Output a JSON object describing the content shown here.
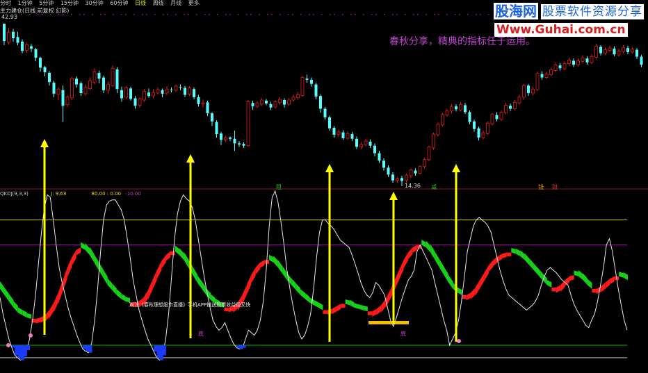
{
  "toolbar": {
    "items": [
      "分时",
      "1分钟",
      "5分钟",
      "15分钟",
      "30分钟",
      "60分钟",
      "日线",
      "周线",
      "月线",
      "更多"
    ],
    "active": "日线"
  },
  "chart_title": "主力建仓(日线 前复权 幻影)",
  "watermark": {
    "logo": "股海网",
    "tagline": "股票软件资源分享",
    "site": "Www.Guhai.com.cn"
  },
  "promo_text": "春秋分享，精典的指标任于运用。",
  "annotation": "观注《春秋理想股市直播》手机APP推送股票收益稳又快",
  "colors": {
    "up_candle": "#e81a1a",
    "down_candle": "#54ffff",
    "arrow": "#ffff00",
    "band_up": "#ff1a1a",
    "band_down": "#16d01a",
    "bottom_block": "#1a3aff",
    "line_upper": "#d2c000",
    "line_mid": "#b400b4",
    "line_lower": "#10b010"
  },
  "chart_data": [
    {
      "type": "candlestick",
      "high_label": "42.93",
      "low_label": "14.36",
      "markers": [
        "阻",
        "减",
        "钱",
        "财"
      ],
      "candles": [
        [
          42.5,
          39.5,
          40.2,
          38.8
        ],
        [
          39.3,
          41.0,
          41.8,
          38.9
        ],
        [
          41.1,
          40.0,
          41.6,
          39.4
        ],
        [
          40.2,
          39.2,
          41.1,
          38.8
        ],
        [
          39.4,
          37.8,
          39.8,
          37.4
        ],
        [
          37.9,
          38.9,
          39.2,
          37.5
        ],
        [
          38.6,
          38.2,
          39.0,
          37.6
        ],
        [
          38.1,
          36.6,
          38.3,
          36.0
        ],
        [
          36.6,
          34.9,
          36.8,
          34.2
        ],
        [
          35.0,
          34.1,
          35.2,
          33.4
        ],
        [
          34.0,
          32.4,
          34.3,
          31.8
        ],
        [
          32.3,
          30.4,
          32.6,
          29.8
        ],
        [
          30.3,
          31.2,
          31.5,
          29.3
        ],
        [
          31.0,
          28.3,
          31.8,
          25.5
        ],
        [
          28.5,
          29.8,
          30.2,
          28.1
        ],
        [
          29.7,
          33.0,
          33.3,
          29.3
        ],
        [
          33.0,
          32.0,
          33.4,
          31.4
        ],
        [
          32.2,
          30.5,
          32.5,
          30.0
        ],
        [
          30.4,
          31.5,
          32.0,
          30.0
        ],
        [
          31.3,
          32.6,
          33.2,
          31.0
        ],
        [
          32.4,
          34.2,
          34.8,
          32.0
        ],
        [
          34.0,
          33.0,
          34.4,
          32.2
        ],
        [
          33.2,
          31.0,
          33.5,
          30.5
        ],
        [
          31.0,
          32.0,
          32.5,
          30.4
        ],
        [
          31.8,
          34.8,
          35.3,
          31.6
        ],
        [
          34.6,
          31.2,
          35.0,
          30.5
        ],
        [
          31.0,
          29.6,
          31.6,
          29.0
        ],
        [
          29.8,
          31.4,
          31.7,
          29.5
        ],
        [
          31.3,
          29.5,
          31.6,
          29.2
        ],
        [
          29.6,
          28.3,
          30.0,
          27.8
        ],
        [
          28.4,
          29.5,
          29.8,
          28.0
        ],
        [
          29.3,
          30.8,
          31.2,
          29.0
        ],
        [
          30.6,
          30.0,
          31.3,
          29.7
        ],
        [
          30.0,
          30.6,
          31.2,
          29.6
        ],
        [
          30.5,
          31.1,
          31.5,
          30.2
        ],
        [
          31.0,
          30.4,
          31.3,
          29.8
        ],
        [
          30.5,
          31.2,
          31.7,
          30.2
        ],
        [
          31.1,
          31.0,
          31.5,
          30.6
        ],
        [
          31.0,
          31.7,
          32.0,
          30.7
        ],
        [
          31.6,
          31.5,
          32.0,
          31.0
        ],
        [
          31.4,
          30.2,
          31.7,
          29.8
        ],
        [
          30.3,
          31.4,
          31.7,
          30.0
        ],
        [
          31.2,
          29.8,
          31.5,
          29.4
        ],
        [
          29.8,
          28.6,
          30.2,
          28.2
        ],
        [
          28.6,
          28.8,
          29.4,
          28.0
        ],
        [
          28.9,
          27.0,
          29.2,
          26.5
        ],
        [
          27.0,
          25.6,
          27.2,
          24.8
        ],
        [
          25.5,
          23.4,
          25.8,
          22.8
        ],
        [
          23.5,
          22.4,
          23.8,
          21.5
        ],
        [
          22.4,
          22.8,
          23.1,
          22.0
        ],
        [
          22.8,
          22.6,
          23.0,
          22.2
        ],
        [
          22.6,
          21.8,
          24.0,
          20.5
        ],
        [
          21.8,
          21.6,
          22.2,
          21.2
        ],
        [
          21.7,
          21.4,
          22.0,
          21.0
        ],
        [
          21.4,
          29.0,
          29.3,
          21.2
        ],
        [
          28.8,
          28.2,
          29.2,
          27.6
        ],
        [
          28.2,
          28.8,
          29.1,
          27.9
        ],
        [
          28.6,
          29.3,
          29.6,
          28.3
        ],
        [
          29.2,
          28.7,
          29.5,
          28.4
        ],
        [
          28.6,
          28.0,
          29.0,
          27.6
        ],
        [
          28.1,
          29.0,
          29.3,
          27.8
        ],
        [
          28.9,
          29.4,
          29.8,
          28.5
        ],
        [
          29.3,
          28.5,
          29.6,
          28.0
        ],
        [
          28.6,
          29.3,
          29.6,
          28.3
        ],
        [
          29.3,
          29.8,
          30.3,
          29.0
        ],
        [
          29.7,
          30.2,
          30.7,
          29.4
        ],
        [
          30.1,
          33.2,
          33.5,
          29.9
        ],
        [
          33.0,
          32.8,
          33.7,
          32.3
        ],
        [
          32.8,
          32.1,
          33.2,
          31.6
        ],
        [
          32.0,
          29.9,
          32.3,
          29.4
        ],
        [
          30.0,
          27.8,
          30.3,
          27.1
        ],
        [
          27.8,
          26.3,
          28.1,
          25.9
        ],
        [
          26.3,
          24.4,
          26.6,
          24.0
        ],
        [
          24.5,
          23.3,
          24.8,
          22.8
        ],
        [
          23.4,
          23.8,
          24.2,
          22.9
        ],
        [
          23.7,
          22.7,
          24.1,
          22.4
        ],
        [
          22.7,
          23.5,
          23.9,
          22.4
        ],
        [
          23.4,
          22.6,
          23.8,
          22.2
        ],
        [
          22.6,
          21.2,
          23.0,
          20.8
        ],
        [
          21.2,
          21.6,
          22.0,
          20.8
        ],
        [
          21.6,
          22.2,
          22.6,
          21.3
        ],
        [
          22.1,
          21.4,
          22.5,
          21.0
        ],
        [
          21.4,
          20.1,
          21.8,
          19.6
        ],
        [
          20.1,
          18.8,
          20.5,
          18.4
        ],
        [
          18.8,
          17.6,
          19.2,
          17.1
        ],
        [
          17.6,
          16.4,
          18.0,
          16.0
        ],
        [
          16.4,
          15.4,
          16.8,
          15.0
        ],
        [
          15.4,
          15.7,
          16.0,
          15.0
        ],
        [
          15.8,
          15.3,
          16.2,
          14.4
        ],
        [
          15.4,
          16.3,
          16.6,
          15.0
        ],
        [
          16.2,
          17.2,
          17.5,
          15.8
        ],
        [
          17.1,
          16.6,
          17.5,
          16.2
        ],
        [
          16.6,
          17.8,
          18.0,
          16.4
        ],
        [
          17.8,
          19.0,
          19.3,
          17.5
        ],
        [
          19.0,
          21.2,
          21.4,
          18.7
        ],
        [
          21.0,
          23.4,
          23.7,
          20.7
        ],
        [
          23.3,
          25.1,
          25.4,
          23.0
        ],
        [
          25.0,
          26.8,
          27.1,
          24.7
        ],
        [
          26.7,
          27.4,
          27.8,
          26.4
        ],
        [
          27.4,
          28.2,
          28.6,
          27.0
        ],
        [
          28.2,
          27.7,
          28.6,
          27.3
        ],
        [
          27.6,
          28.5,
          28.9,
          27.3
        ],
        [
          28.4,
          27.2,
          28.8,
          26.9
        ],
        [
          27.2,
          25.5,
          27.5,
          25.1
        ],
        [
          25.6,
          24.3,
          25.9,
          23.8
        ],
        [
          24.4,
          22.8,
          24.7,
          22.3
        ],
        [
          22.8,
          23.6,
          24.0,
          22.5
        ],
        [
          23.5,
          25.3,
          25.6,
          23.3
        ],
        [
          25.2,
          26.8,
          27.1,
          24.9
        ],
        [
          26.7,
          26.0,
          27.2,
          25.6
        ],
        [
          26.0,
          27.2,
          27.5,
          25.7
        ],
        [
          27.1,
          28.4,
          28.8,
          26.8
        ],
        [
          28.3,
          27.8,
          28.7,
          27.4
        ],
        [
          27.8,
          28.9,
          29.3,
          27.5
        ],
        [
          28.8,
          29.8,
          30.2,
          28.5
        ],
        [
          29.8,
          31.8,
          32.1,
          29.4
        ],
        [
          31.8,
          30.5,
          32.1,
          30.0
        ],
        [
          30.5,
          31.2,
          31.6,
          30.1
        ],
        [
          31.1,
          33.9,
          34.2,
          30.9
        ],
        [
          33.8,
          33.2,
          34.3,
          32.8
        ],
        [
          33.2,
          33.8,
          34.2,
          32.9
        ],
        [
          33.7,
          34.5,
          34.9,
          33.4
        ],
        [
          34.4,
          35.4,
          35.8,
          34.1
        ],
        [
          35.3,
          34.8,
          35.7,
          34.4
        ],
        [
          34.7,
          35.6,
          36.0,
          34.4
        ],
        [
          35.6,
          36.2,
          36.6,
          35.2
        ],
        [
          36.1,
          35.4,
          36.5,
          35.0
        ],
        [
          35.4,
          36.1,
          36.5,
          35.1
        ],
        [
          36.0,
          36.6,
          37.0,
          35.7
        ],
        [
          36.5,
          35.8,
          36.9,
          35.4
        ],
        [
          35.8,
          36.8,
          37.2,
          35.5
        ],
        [
          36.7,
          38.6,
          39.0,
          36.4
        ],
        [
          38.5,
          37.4,
          38.8,
          37.0
        ],
        [
          37.4,
          38.0,
          38.4,
          37.1
        ],
        [
          37.9,
          38.3,
          38.7,
          37.6
        ],
        [
          38.2,
          37.2,
          38.6,
          36.9
        ],
        [
          37.1,
          37.8,
          38.2,
          36.8
        ],
        [
          37.7,
          38.4,
          38.8,
          37.4
        ],
        [
          38.3,
          37.6,
          38.7,
          37.2
        ],
        [
          37.6,
          38.1,
          38.5,
          37.3
        ],
        [
          38.0,
          36.8,
          38.3,
          36.4
        ],
        [
          36.8,
          35.4,
          37.1,
          35.0
        ]
      ]
    },
    {
      "type": "line",
      "title": "QKDJ(9,3,3)",
      "values_text": [
        "J: 9.63",
        "80.00 : 0.00",
        "-10.00"
      ],
      "levels": [
        100,
        80,
        0,
        -10
      ],
      "ylim": [
        -15,
        130
      ],
      "bottom_label": "底",
      "series": [
        {
          "name": "J",
          "values": [
            38,
            25,
            15,
            5,
            -2,
            -8,
            -10,
            -12,
            -9,
            -4,
            5,
            20,
            40,
            65,
            90,
            110,
            120,
            118,
            100,
            80,
            62,
            50,
            40,
            30,
            22,
            15,
            8,
            2,
            -3,
            -5,
            -6,
            2,
            20,
            45,
            75,
            100,
            112,
            115,
            116,
            116,
            112,
            108,
            100,
            85,
            70,
            52,
            40,
            28,
            20,
            12,
            5,
            0,
            -5,
            -10,
            -12,
            -8,
            5,
            25,
            55,
            85,
            105,
            115,
            120,
            117,
            115,
            110,
            100,
            85,
            70,
            55,
            42,
            30,
            20,
            15,
            12,
            14,
            18,
            12,
            6,
            1,
            -2,
            -3,
            -2,
            5,
            12,
            10,
            8,
            12,
            20,
            35,
            60,
            95,
            118,
            123,
            114,
            98,
            80,
            60,
            45,
            32,
            20,
            10,
            5,
            8,
            15,
            25,
            45,
            70,
            90,
            100,
            100,
            97,
            95,
            92,
            88,
            84,
            82,
            80,
            78,
            72,
            65,
            58,
            50,
            44,
            40,
            38,
            42,
            50,
            48,
            44,
            40,
            30,
            20,
            15,
            22,
            30,
            38,
            45,
            52,
            55,
            60,
            75,
            80,
            75,
            70,
            65,
            60,
            50,
            40,
            30,
            20,
            12,
            0,
            5,
            10,
            20,
            35,
            55,
            75,
            85,
            95,
            100,
            102,
            100,
            98,
            95,
            90,
            80,
            70,
            60,
            52,
            45,
            40,
            38,
            36,
            34,
            32,
            30,
            28,
            30,
            32,
            35,
            40,
            48,
            55,
            60,
            62,
            60,
            58,
            55,
            52,
            50,
            48,
            40,
            33,
            28,
            24,
            20,
            16,
            14,
            20,
            25,
            35,
            48,
            62,
            80,
            85,
            75,
            60,
            45,
            32,
            20,
            12
          ]
        },
        {
          "name": "band",
          "values": [
            45,
            40,
            35,
            30,
            26,
            24,
            22,
            21,
            21,
            22,
            24,
            28,
            34,
            42,
            52,
            62,
            70,
            76,
            78,
            76,
            72,
            66,
            60,
            54,
            48,
            44,
            40,
            37,
            35,
            34,
            34,
            35,
            38,
            44,
            52,
            60,
            67,
            72,
            75,
            75,
            72,
            68,
            62,
            56,
            50,
            45,
            40,
            36,
            33,
            31,
            30,
            30,
            31,
            34,
            40,
            48,
            56,
            62,
            66,
            68,
            68,
            66,
            62,
            57,
            52,
            48,
            44,
            40,
            37,
            34,
            32,
            30,
            28,
            28,
            29,
            31,
            33,
            33,
            32,
            30,
            29,
            28,
            27,
            27,
            29,
            32,
            37,
            44,
            52,
            60,
            68,
            74,
            78,
            80,
            80,
            78,
            74,
            68,
            62,
            56,
            50,
            45,
            42,
            40,
            40,
            42,
            46,
            52,
            58,
            64,
            68,
            71,
            73,
            74,
            74,
            73,
            71,
            68,
            64,
            60,
            56,
            52,
            48,
            46,
            46,
            48,
            52,
            55,
            56,
            55,
            52,
            48,
            45,
            45,
            47,
            50,
            53,
            55,
            55,
            54,
            52
          ]
        }
      ]
    }
  ]
}
